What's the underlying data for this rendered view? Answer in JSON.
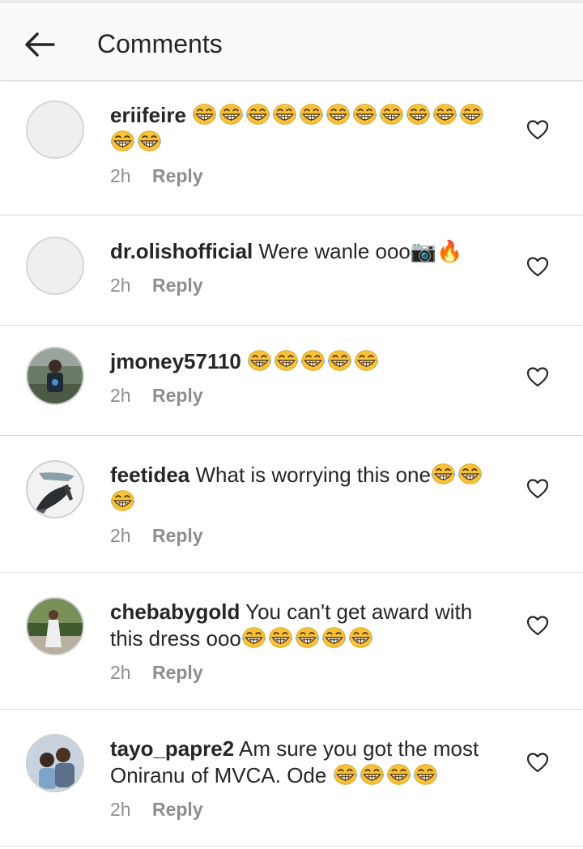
{
  "header": {
    "title": "Comments"
  },
  "comments": [
    {
      "user": "eriifeire",
      "text": "",
      "emoji_count": 13,
      "time": "2h",
      "reply": "Reply"
    },
    {
      "user": "dr.olishofficial",
      "text": "Were wanle ooo📷🔥",
      "emoji_count": 0,
      "time": "2h",
      "reply": "Reply"
    },
    {
      "user": "jmoney57110",
      "text": "",
      "emoji_count": 5,
      "time": "2h",
      "reply": "Reply"
    },
    {
      "user": "feetidea",
      "text": "What is worrying this one",
      "emoji_count": 3,
      "time": "2h",
      "reply": "Reply"
    },
    {
      "user": "chebabygold",
      "text": "You can't get award with this dress ooo",
      "emoji_count": 5,
      "time": "2h",
      "reply": "Reply"
    },
    {
      "user": "tayo_papre2",
      "text": "Am sure you got the most Oniranu of MVCA. Ode ",
      "emoji_count": 4,
      "time": "2h",
      "reply": "Reply"
    }
  ]
}
